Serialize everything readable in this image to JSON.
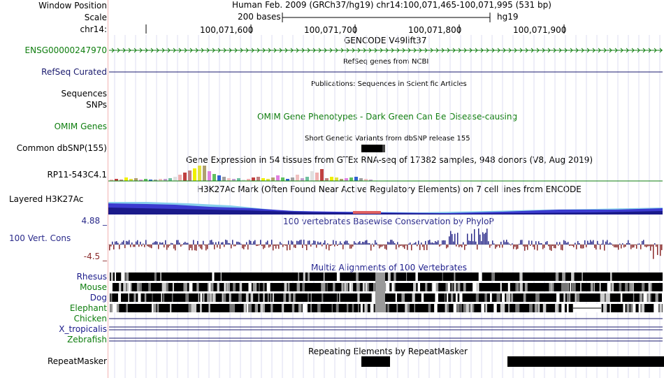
{
  "header": {
    "window_position_label": "Window Position",
    "scale_label": "Scale",
    "chrom_label": "chr14:",
    "assembly_text": "Human Feb. 2009 (GRCh37/hg19)   chr14:100,071,465-100,071,995 (531 bp)",
    "scale_text": "200 bases",
    "scale_db": "hg19",
    "ruler_ticks": [
      "100,071,600",
      "100,071,700",
      "100,071,800",
      "100,071,900"
    ]
  },
  "tracks": {
    "gencode": {
      "title": "GENCODE V49lift37",
      "label": "ENSG00000247970",
      "color": "#0e7d0e"
    },
    "refseq": {
      "title": "RefSeq genes from NCBI",
      "label": "RefSeq Curated",
      "color": "#1a1a6e"
    },
    "pubs": {
      "title": "Publications: Sequences in Scientific Articles",
      "label1": "Sequences",
      "label2": "SNPs"
    },
    "omim": {
      "title": "OMIM Gene Phenotypes - Dark Green Can Be Disease-causing",
      "label": "OMIM Genes",
      "color": "#0e7d0e"
    },
    "dbsnp": {
      "title": "Short Genetic Variants from dbSNP release 155",
      "label": "Common dbSNP(155)"
    },
    "gtex": {
      "title": "Gene Expression in 54 tissues from GTEx RNA-seq of 17382 samples, 948 donors (V8, Aug 2019)",
      "label": "RP11-543C4.1"
    },
    "h3k27ac": {
      "title": "H3K27Ac Mark (Often Found Near Active Regulatory Elements) on 7 cell lines from ENCODE",
      "label": "Layered H3K27Ac"
    },
    "phylop": {
      "title": "100 vertebrates Basewise Conservation by PhyloP",
      "label": "100 Vert. Cons",
      "max": "4.88 _",
      "min": "-4.5 _",
      "color": "#2a2a8a"
    },
    "multiz": {
      "title": "Multiz Alignments of 100 Vertebrates",
      "species": [
        {
          "name": "Rhesus",
          "color": "#1a1a8a"
        },
        {
          "name": "Mouse",
          "color": "#0e7d0e"
        },
        {
          "name": "Dog",
          "color": "#1a1a8a"
        },
        {
          "name": "Elephant",
          "color": "#0e7d0e"
        },
        {
          "name": "Chicken",
          "color": "#0e7d0e"
        },
        {
          "name": "X_tropicalis",
          "color": "#1a1a8a"
        },
        {
          "name": "Zebrafish",
          "color": "#0e7d0e"
        }
      ]
    },
    "repeatmasker": {
      "title": "Repeating Elements by RepeatMasker",
      "label": "RepeatMasker"
    }
  }
}
